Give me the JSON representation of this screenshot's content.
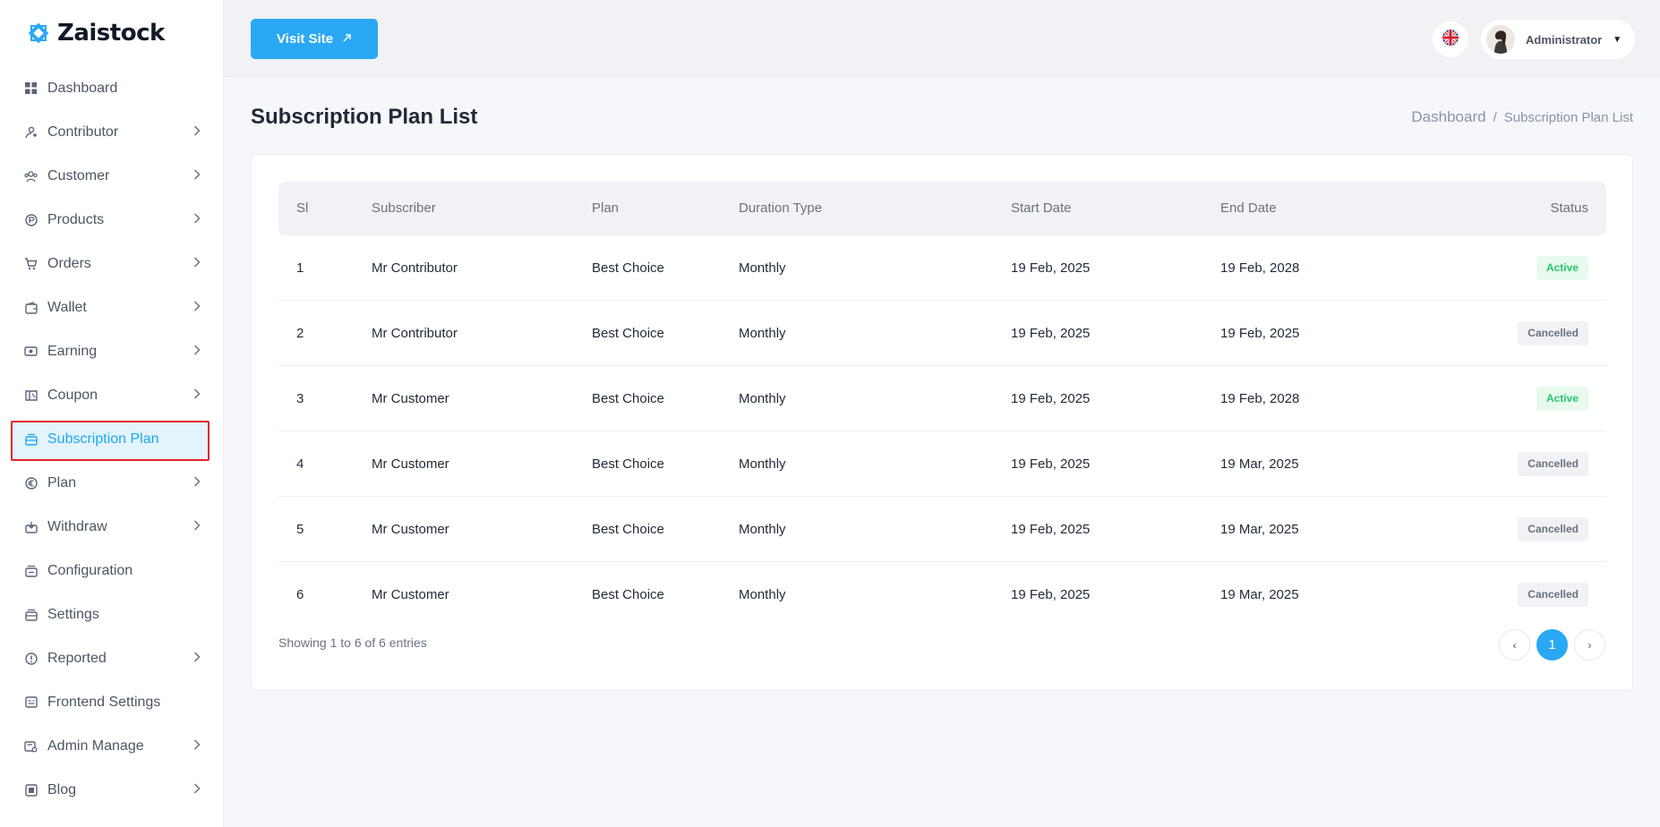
{
  "brand": {
    "name": "Zaistock",
    "accent": "#2aa8f4"
  },
  "sidebar": {
    "items": [
      {
        "label": "Dashboard",
        "icon": "dashboard-icon",
        "chevron": false
      },
      {
        "label": "Contributor",
        "icon": "contributor-icon",
        "chevron": true
      },
      {
        "label": "Customer",
        "icon": "customer-icon",
        "chevron": true
      },
      {
        "label": "Products",
        "icon": "products-icon",
        "chevron": true
      },
      {
        "label": "Orders",
        "icon": "cart-icon",
        "chevron": true
      },
      {
        "label": "Wallet",
        "icon": "wallet-icon",
        "chevron": true
      },
      {
        "label": "Earning",
        "icon": "money-icon",
        "chevron": true
      },
      {
        "label": "Coupon",
        "icon": "coupon-icon",
        "chevron": true
      },
      {
        "label": "Subscription Plan",
        "icon": "subscription-icon",
        "chevron": false,
        "active": true
      },
      {
        "label": "Plan",
        "icon": "euro-icon",
        "chevron": true
      },
      {
        "label": "Withdraw",
        "icon": "withdraw-icon",
        "chevron": true
      },
      {
        "label": "Configuration",
        "icon": "configuration-icon",
        "chevron": false
      },
      {
        "label": "Settings",
        "icon": "settings-icon",
        "chevron": false
      },
      {
        "label": "Reported",
        "icon": "alert-icon",
        "chevron": true
      },
      {
        "label": "Frontend Settings",
        "icon": "frontend-icon",
        "chevron": false
      },
      {
        "label": "Admin Manage",
        "icon": "admin-icon",
        "chevron": true
      },
      {
        "label": "Blog",
        "icon": "blog-icon",
        "chevron": true
      }
    ]
  },
  "topbar": {
    "visit_label": "Visit Site",
    "user_name": "Administrator",
    "language_icon": "uk-flag-icon"
  },
  "page": {
    "title": "Subscription Plan List",
    "breadcrumb_home": "Dashboard",
    "breadcrumb_sep": "/",
    "breadcrumb_current": "Subscription Plan List"
  },
  "table": {
    "headers": [
      "Sl",
      "Subscriber",
      "Plan",
      "Duration Type",
      "Start Date",
      "End Date",
      "Status"
    ],
    "rows": [
      {
        "sl": "1",
        "subscriber": "Mr Contributor",
        "plan": "Best Choice",
        "duration": "Monthly",
        "start": "19 Feb, 2025",
        "end": "19 Feb, 2028",
        "status": "Active"
      },
      {
        "sl": "2",
        "subscriber": "Mr Contributor",
        "plan": "Best Choice",
        "duration": "Monthly",
        "start": "19 Feb, 2025",
        "end": "19 Feb, 2025",
        "status": "Cancelled"
      },
      {
        "sl": "3",
        "subscriber": "Mr Customer",
        "plan": "Best Choice",
        "duration": "Monthly",
        "start": "19 Feb, 2025",
        "end": "19 Feb, 2028",
        "status": "Active"
      },
      {
        "sl": "4",
        "subscriber": "Mr Customer",
        "plan": "Best Choice",
        "duration": "Monthly",
        "start": "19 Feb, 2025",
        "end": "19 Mar, 2025",
        "status": "Cancelled"
      },
      {
        "sl": "5",
        "subscriber": "Mr Customer",
        "plan": "Best Choice",
        "duration": "Monthly",
        "start": "19 Feb, 2025",
        "end": "19 Mar, 2025",
        "status": "Cancelled"
      },
      {
        "sl": "6",
        "subscriber": "Mr Customer",
        "plan": "Best Choice",
        "duration": "Monthly",
        "start": "19 Feb, 2025",
        "end": "19 Mar, 2025",
        "status": "Cancelled"
      }
    ],
    "showing": "Showing 1 to 6 of 6 entries",
    "pagination": {
      "prev": "‹",
      "current": "1",
      "next": "›"
    }
  }
}
